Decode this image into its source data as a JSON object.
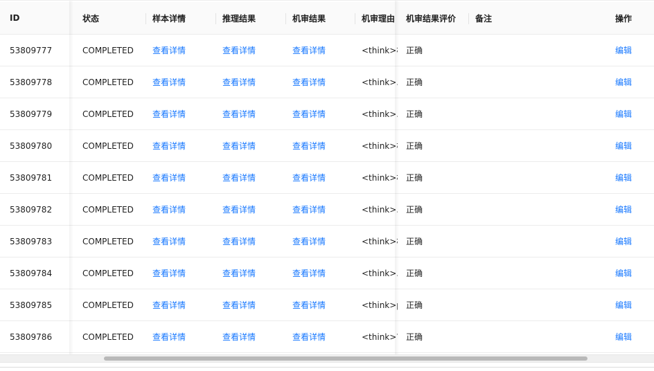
{
  "headers": {
    "id": "ID",
    "status": "状态",
    "sample": "样本详情",
    "inference": "推理结果",
    "machine_result": "机审结果",
    "machine_reason": "机审理由",
    "machine_eval": "机审结果评价",
    "note": "备注",
    "operation": "操作"
  },
  "rows": [
    {
      "id": "53809777",
      "status": "COMPLETED",
      "sample": "查看详情",
      "inference": "查看详情",
      "machine_result": "查看详情",
      "reason": "<think>根",
      "eval": "正确",
      "note": "",
      "op": "编辑"
    },
    {
      "id": "53809778",
      "status": "COMPLETED",
      "sample": "查看详情",
      "inference": "查看详情",
      "machine_result": "查看详情",
      "reason": "<think>...",
      "eval": "正确",
      "note": "",
      "op": "编辑"
    },
    {
      "id": "53809779",
      "status": "COMPLETED",
      "sample": "查看详情",
      "inference": "查看详情",
      "machine_result": "查看详情",
      "reason": "<think>...",
      "eval": "正确",
      "note": "",
      "op": "编辑"
    },
    {
      "id": "53809780",
      "status": "COMPLETED",
      "sample": "查看详情",
      "inference": "查看详情",
      "machine_result": "查看详情",
      "reason": "<think>根",
      "eval": "正确",
      "note": "",
      "op": "编辑"
    },
    {
      "id": "53809781",
      "status": "COMPLETED",
      "sample": "查看详情",
      "inference": "查看详情",
      "machine_result": "查看详情",
      "reason": "<think>根",
      "eval": "正确",
      "note": "",
      "op": "编辑"
    },
    {
      "id": "53809782",
      "status": "COMPLETED",
      "sample": "查看详情",
      "inference": "查看详情",
      "machine_result": "查看详情",
      "reason": "<think>...",
      "eval": "正确",
      "note": "",
      "op": "编辑"
    },
    {
      "id": "53809783",
      "status": "COMPLETED",
      "sample": "查看详情",
      "inference": "查看详情",
      "machine_result": "查看详情",
      "reason": "<think>根",
      "eval": "正确",
      "note": "",
      "op": "编辑"
    },
    {
      "id": "53809784",
      "status": "COMPLETED",
      "sample": "查看详情",
      "inference": "查看详情",
      "machine_result": "查看详情",
      "reason": "<think>...",
      "eval": "正确",
      "note": "",
      "op": "编辑"
    },
    {
      "id": "53809785",
      "status": "COMPLETED",
      "sample": "查看详情",
      "inference": "查看详情",
      "machine_result": "查看详情",
      "reason": "<think>pl",
      "eval": "正确",
      "note": "",
      "op": "编辑"
    },
    {
      "id": "53809786",
      "status": "COMPLETED",
      "sample": "查看详情",
      "inference": "查看详情",
      "machine_result": "查看详情",
      "reason": "<think>首",
      "eval": "正确",
      "note": "",
      "op": "编辑"
    }
  ],
  "colors": {
    "link": "#1677ff",
    "header_bg": "#fafafa",
    "border": "#ececec"
  }
}
